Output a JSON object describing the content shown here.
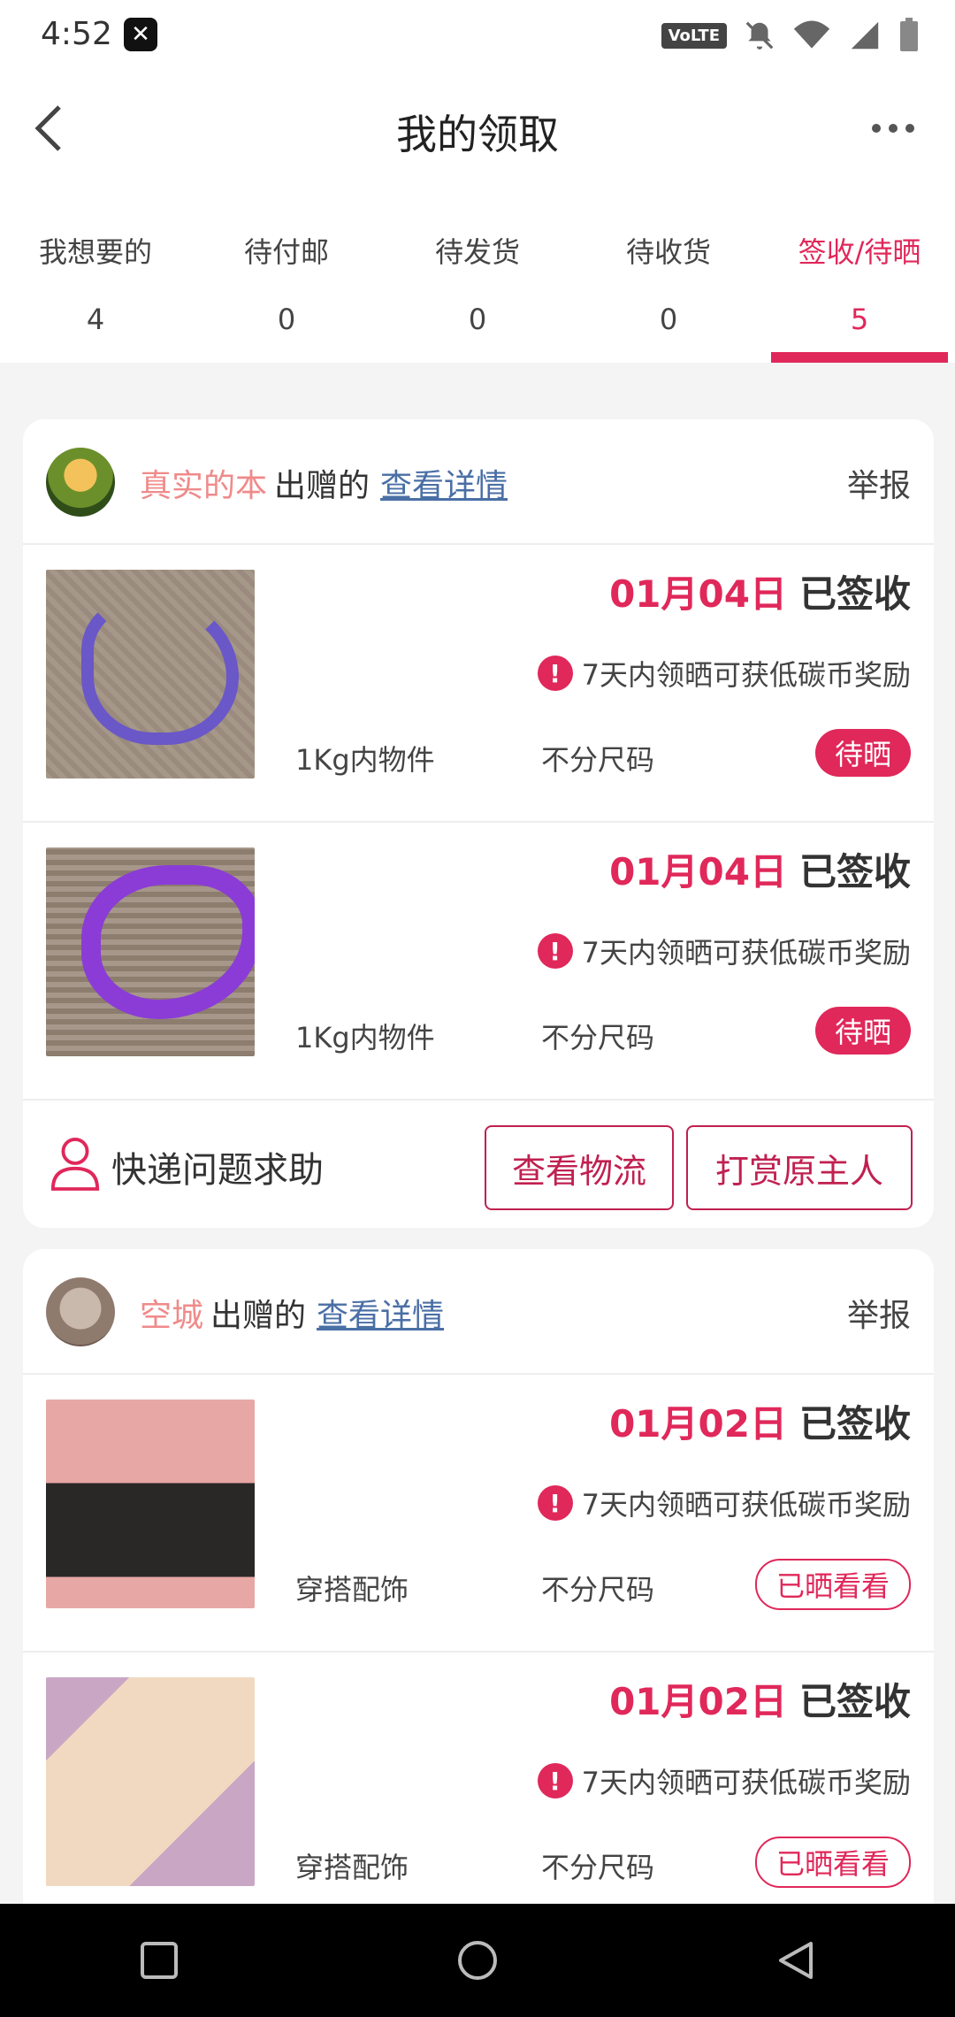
{
  "status_bar": {
    "time": "4:52",
    "volte": "VoLTE"
  },
  "header": {
    "title": "我的领取"
  },
  "tabs": [
    {
      "label": "我想要的",
      "count": "4"
    },
    {
      "label": "待付邮",
      "count": "0"
    },
    {
      "label": "待发货",
      "count": "0"
    },
    {
      "label": "待收货",
      "count": "0"
    },
    {
      "label": "签收/待晒",
      "count": "5"
    }
  ],
  "cards": [
    {
      "giver": "真实的本",
      "giver_suffix": "出赠的",
      "detail_link": "查看详情",
      "report": "举报",
      "items": [
        {
          "date": "01月04日",
          "status": "已签收",
          "reward": "7天内领晒可获低碳币奖励",
          "category": "1Kg内物件",
          "size": "不分尺码",
          "badge": "待晒"
        },
        {
          "date": "01月04日",
          "status": "已签收",
          "reward": "7天内领晒可获低碳币奖励",
          "category": "1Kg内物件",
          "size": "不分尺码",
          "badge": "待晒"
        }
      ],
      "footer": {
        "help_text": "快递问题求助",
        "logistics_button": "查看物流",
        "tip_button": "打赏原主人"
      }
    },
    {
      "giver": "空城",
      "giver_suffix": "出赠的",
      "detail_link": "查看详情",
      "report": "举报",
      "items": [
        {
          "date": "01月02日",
          "status": "已签收",
          "reward": "7天内领晒可获低碳币奖励",
          "category": "穿搭配饰",
          "size": "不分尺码",
          "badge": "已晒看看"
        },
        {
          "date": "01月02日",
          "status": "已签收",
          "reward": "7天内领晒可获低碳币奖励",
          "category": "穿搭配饰",
          "size": "不分尺码",
          "badge": "已晒看看"
        }
      ]
    }
  ],
  "colors": {
    "accent": "#e0285a",
    "link": "#4a6fa5",
    "giver_name": "#f08a8a"
  }
}
